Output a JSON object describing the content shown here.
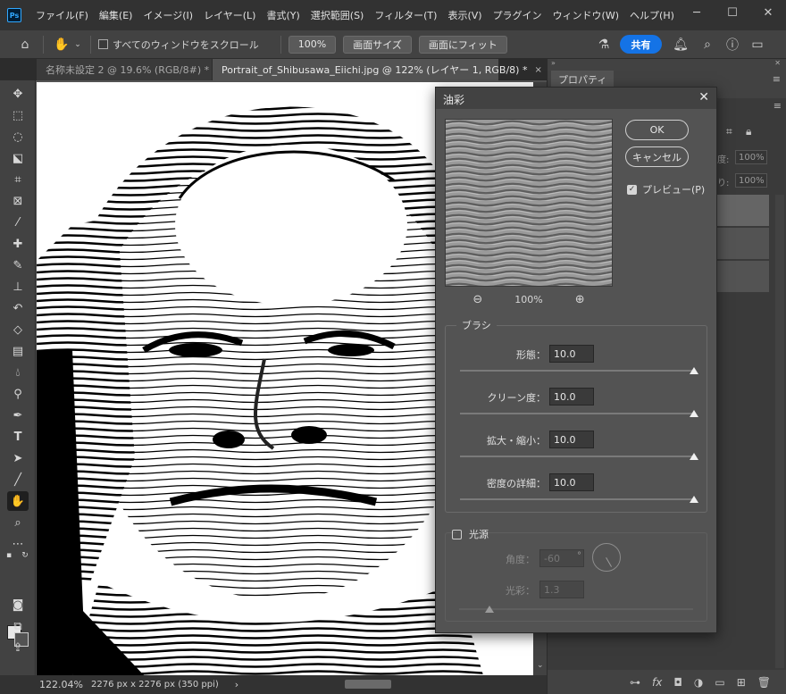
{
  "app": {
    "logo": "Ps"
  },
  "menu": [
    "ファイル(F)",
    "編集(E)",
    "イメージ(I)",
    "レイヤー(L)",
    "書式(Y)",
    "選択範囲(S)",
    "フィルター(T)",
    "表示(V)",
    "プラグイン",
    "ウィンドウ(W)",
    "ヘルプ(H)"
  ],
  "window_controls": {
    "minimize": "─",
    "maximize": "☐",
    "close": "✕"
  },
  "options": {
    "all_windows_label": "すべてのウィンドウをスクロール",
    "zoom_100": "100%",
    "fit_screen": "画面サイズ",
    "fill_screen": "画面にフィット",
    "share": "共有"
  },
  "tabs": [
    {
      "label": "名称未設定 2 @ 19.6% (RGB/8#) *",
      "close": "×"
    },
    {
      "label": "Portrait_of_Shibusawa_Eiichi.jpg @ 122% (レイヤー 1, RGB/8) *",
      "close": "×"
    }
  ],
  "status": {
    "zoom": "122.04%",
    "doc_size": "2276 px x 2276 px (350 ppi)",
    "arrow": "›"
  },
  "panel": {
    "properties_tab": "プロパティ",
    "inputs": [
      "100%",
      "100%"
    ],
    "input_labels": [
      "度:",
      "り:"
    ]
  },
  "dialog": {
    "title": "油彩",
    "close": "✕",
    "zoom": "100%",
    "zoom_out": "⊖",
    "zoom_in": "⊕",
    "ok": "OK",
    "cancel": "キャンセル",
    "preview_label": "プレビュー(P)",
    "preview_checked": true,
    "brush": {
      "legend": "ブラシ",
      "fields": [
        {
          "label": "形態：",
          "value": "10.0",
          "level": 1.0
        },
        {
          "label": "クリーン度：",
          "value": "10.0",
          "level": 1.0
        },
        {
          "label": "拡大・縮小：",
          "value": "10.0",
          "level": 1.0
        },
        {
          "label": "密度の詳細：",
          "value": "10.0",
          "level": 1.0
        }
      ]
    },
    "lighting": {
      "legend": "光源",
      "checked": false,
      "angle_label": "角度：",
      "angle_value": "-60",
      "degree_symbol": "°",
      "shine_label": "光彩：",
      "shine_value": "1.3",
      "shine_level": 0.13
    }
  }
}
